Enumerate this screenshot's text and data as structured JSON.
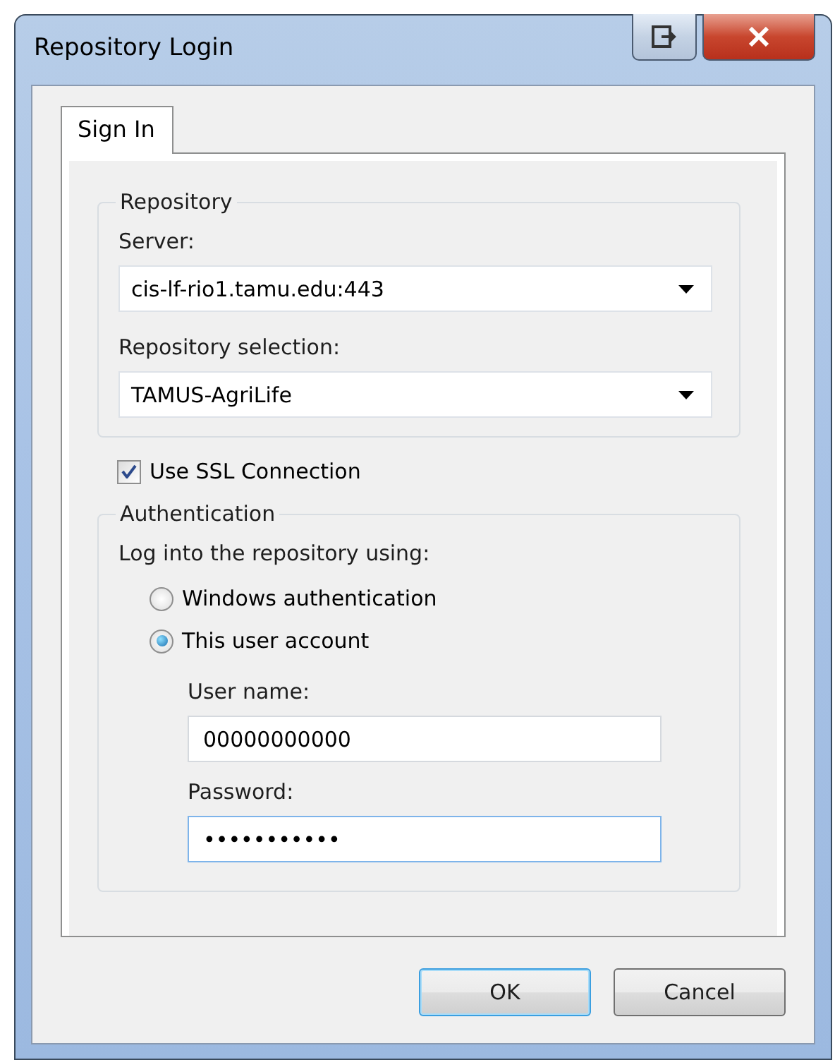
{
  "window": {
    "title": "Repository Login"
  },
  "tabs": [
    {
      "label": "Sign In",
      "selected": true
    }
  ],
  "repository": {
    "title": "Repository",
    "server": {
      "label": "Server:",
      "value": "cis-lf-rio1.tamu.edu:443"
    },
    "selection": {
      "label": "Repository selection:",
      "value": "TAMUS-AgriLife"
    }
  },
  "use_ssl": {
    "label": "Use SSL Connection",
    "checked": true
  },
  "authentication": {
    "title": "Authentication",
    "prompt": "Log into the repository using:",
    "options": [
      {
        "label": "Windows authentication",
        "selected": false
      },
      {
        "label": "This user account",
        "selected": true
      }
    ],
    "user_name": {
      "label": "User name:",
      "value": "00000000000",
      "focused": false
    },
    "password": {
      "label": "Password:",
      "value": "•••••••••••",
      "focused": true
    }
  },
  "buttons": [
    {
      "label": "OK",
      "default": true
    },
    {
      "label": "Cancel",
      "default": false
    }
  ]
}
